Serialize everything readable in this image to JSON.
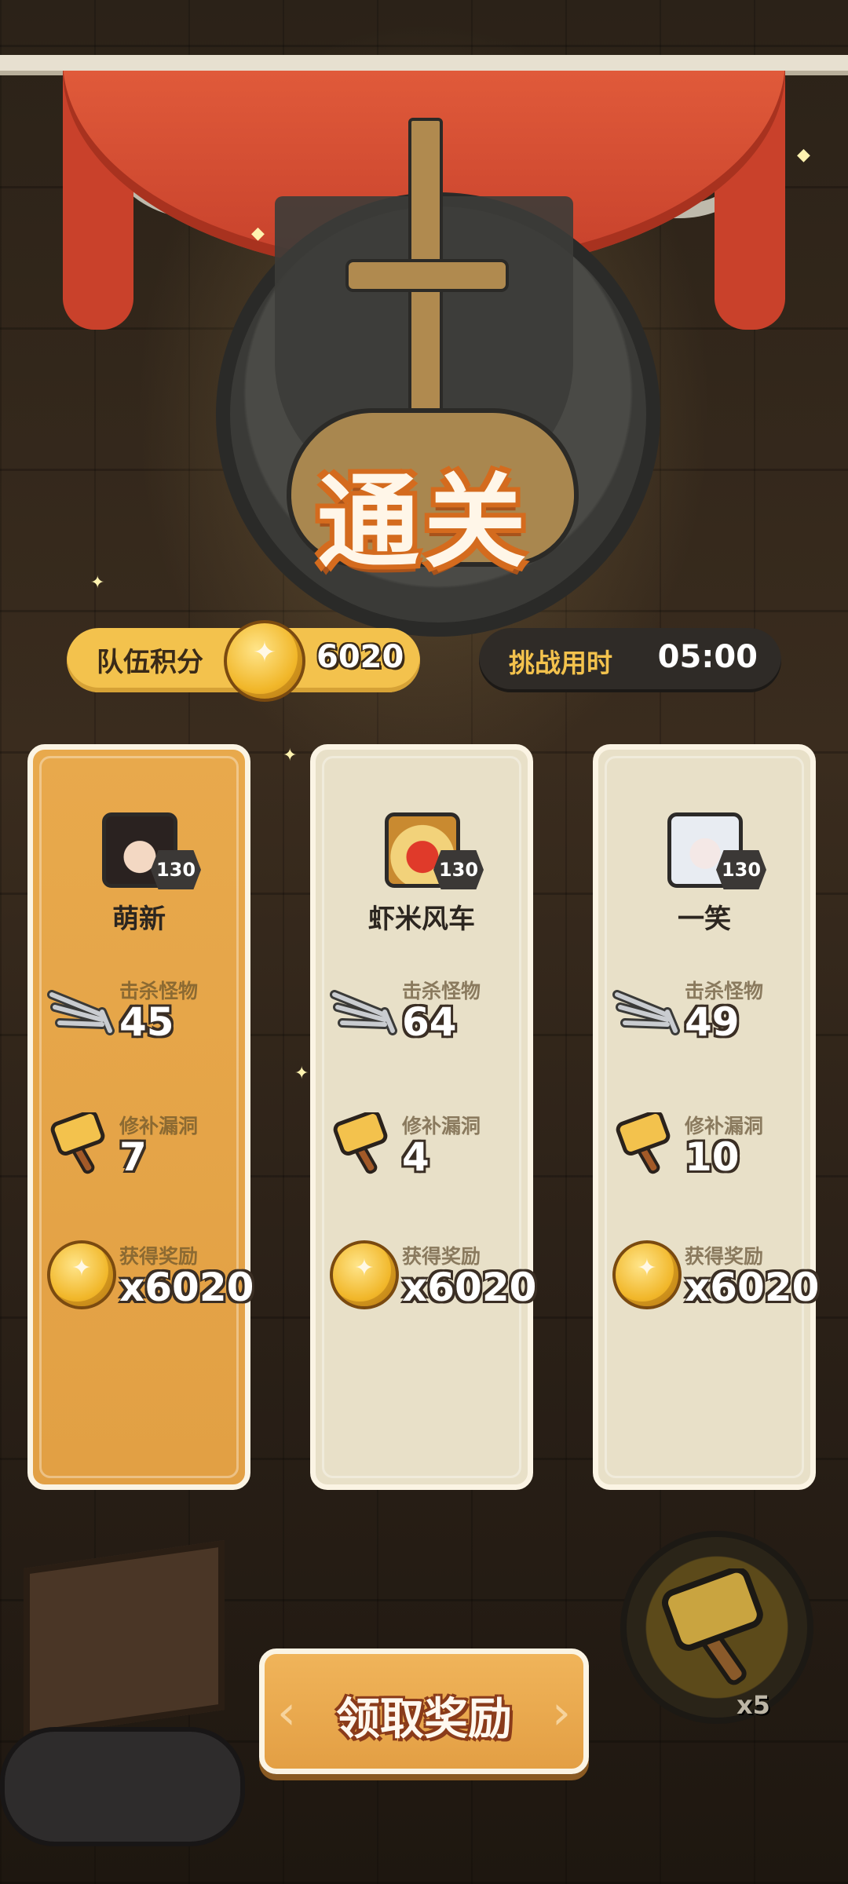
{
  "header": {
    "title": "通关"
  },
  "team_score": {
    "label": "队伍积分",
    "value": "6020",
    "icon": "gold-coin-icon"
  },
  "challenge_time": {
    "label": "挑战用时",
    "value": "05:00"
  },
  "players": [
    {
      "name": "萌新",
      "level": "130",
      "kills_label": "击杀怪物",
      "kills": "45",
      "repairs_label": "修补漏洞",
      "repairs": "7",
      "reward_label": "获得奖励",
      "reward": "x6020",
      "highlighted": true
    },
    {
      "name": "虾米风车",
      "level": "130",
      "kills_label": "击杀怪物",
      "kills": "64",
      "repairs_label": "修补漏洞",
      "repairs": "4",
      "reward_label": "获得奖励",
      "reward": "x6020",
      "highlighted": false
    },
    {
      "name": "一笑",
      "level": "130",
      "kills_label": "击杀怪物",
      "kills": "49",
      "repairs_label": "修补漏洞",
      "repairs": "10",
      "reward_label": "获得奖励",
      "reward": "x6020",
      "highlighted": false
    }
  ],
  "claim_button": {
    "label": "领取奖励"
  },
  "skill_slot": {
    "icon": "hammer-icon",
    "count": "x5"
  },
  "colors": {
    "accent_gold": "#f3c24d",
    "highlight_card": "#e5a548",
    "normal_card": "#e8e0c8",
    "title_orange": "#d46b1e"
  }
}
